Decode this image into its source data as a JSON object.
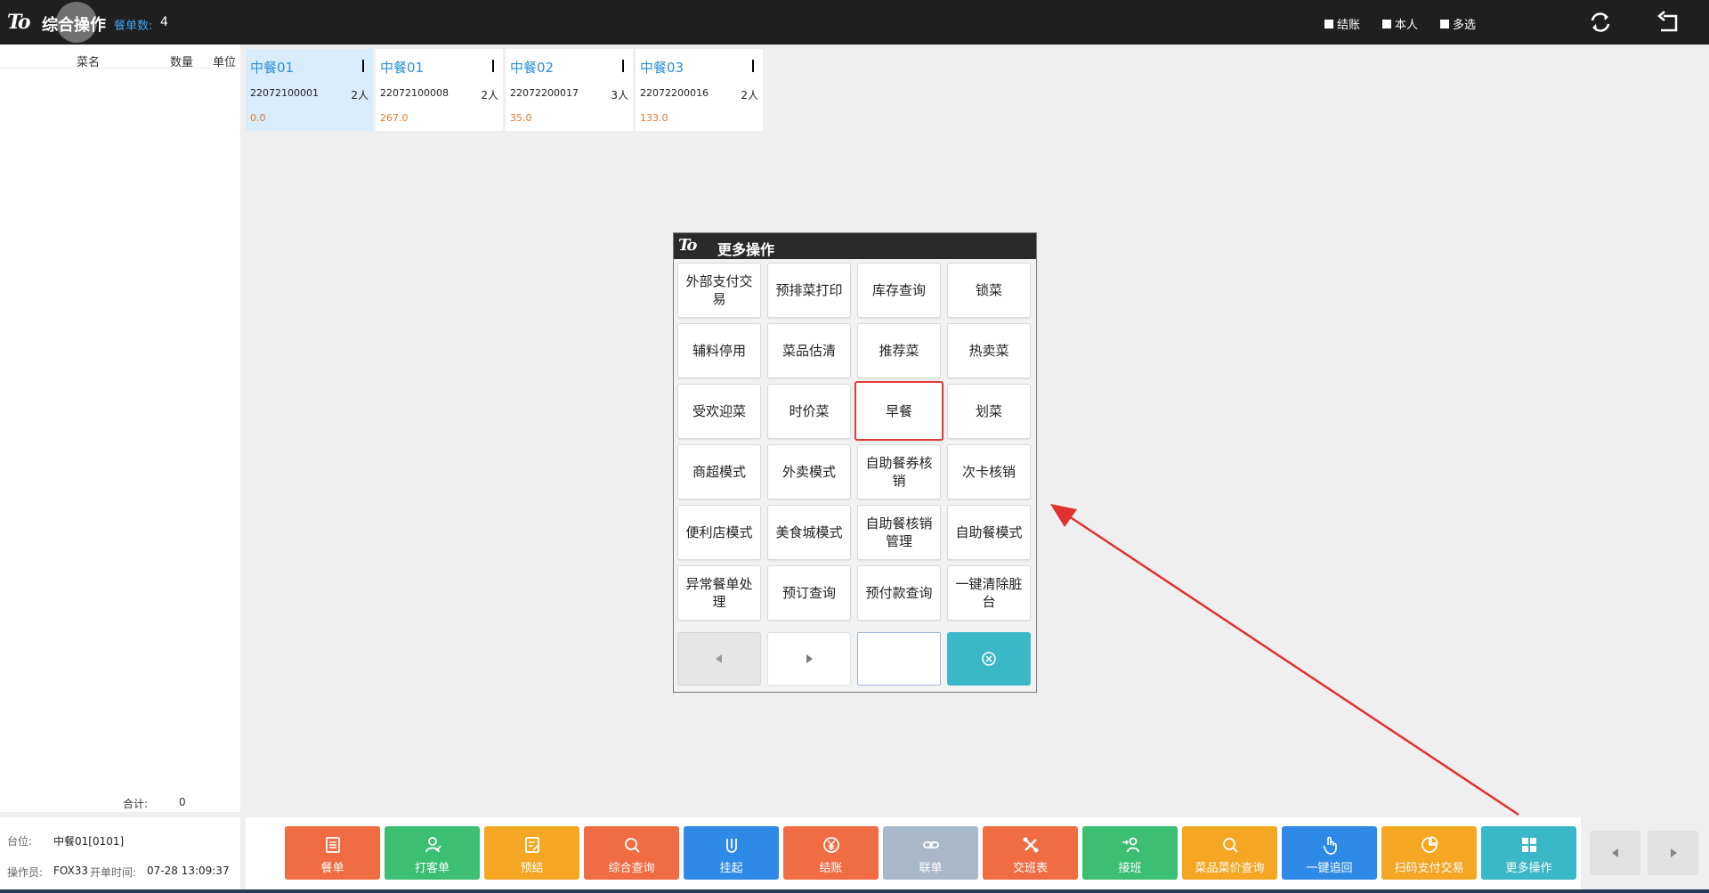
{
  "header": {
    "logo_text": "To",
    "title": "综合操作",
    "order_count_label": "餐单数:",
    "order_count_value": "4",
    "checks": [
      {
        "label": "结账",
        "checked": false
      },
      {
        "label": "本人",
        "checked": false
      },
      {
        "label": "多选",
        "checked": false
      }
    ],
    "refresh_icon": "refresh-icon",
    "back_icon": "return-icon"
  },
  "left_panel": {
    "columns": [
      "菜名",
      "数量",
      "单位"
    ],
    "total_label": "合计:",
    "total_value": "0",
    "table_label": "台位:",
    "table_value": "中餐01[0101]",
    "operator_label": "操作员:",
    "operator_value": "FOX33",
    "open_time_label": "开单时间:",
    "open_time_value": "07-28 13:09:37"
  },
  "orders": [
    {
      "name": "中餐01",
      "no": "22072100001",
      "people": "2人",
      "amount": "0.0",
      "active": true
    },
    {
      "name": "中餐01",
      "no": "22072100008",
      "people": "2人",
      "amount": "267.0",
      "active": false
    },
    {
      "name": "中餐02",
      "no": "22072200017",
      "people": "3人",
      "amount": "35.0",
      "active": false
    },
    {
      "name": "中餐03",
      "no": "22072200016",
      "people": "2人",
      "amount": "133.0",
      "active": false
    }
  ],
  "modal": {
    "logo_text": "To",
    "title": "更多操作",
    "buttons": [
      "外部支付交易",
      "预排菜打印",
      "库存查询",
      "锁菜",
      "辅料停用",
      "菜品估清",
      "推荐菜",
      "热卖菜",
      "受欢迎菜",
      "时价菜",
      "早餐",
      "划菜",
      "商超模式",
      "外卖模式",
      "自助餐券核销",
      "次卡核销",
      "便利店模式",
      "美食城模式",
      "自助餐核销管理",
      "自助餐模式",
      "异常餐单处理",
      "预订查询",
      "预付款查询",
      "一键清除脏台"
    ],
    "highlighted_button": "早餐",
    "page_input_value": "",
    "prev_icon": "triangle-left-icon",
    "next_icon": "triangle-right-icon",
    "close_icon": "close-circle-icon"
  },
  "bottom_buttons": [
    {
      "label": "餐单",
      "color": "#f06c43",
      "icon": "list-icon"
    },
    {
      "label": "打客单",
      "color": "#3cbf73",
      "icon": "user-print-icon"
    },
    {
      "label": "预结",
      "color": "#f5a623",
      "icon": "note-icon"
    },
    {
      "label": "综合查询",
      "color": "#f06c43",
      "icon": "search-icon"
    },
    {
      "label": "挂起",
      "color": "#2e8ae6",
      "icon": "hang-icon"
    },
    {
      "label": "结账",
      "color": "#f06c43",
      "icon": "yen-icon"
    },
    {
      "label": "联单",
      "color": "#a9b8c8",
      "icon": "link-icon"
    },
    {
      "label": "交班表",
      "color": "#f06c43",
      "icon": "tools-icon"
    },
    {
      "label": "接班",
      "color": "#3cbf73",
      "icon": "user-arrow-icon"
    },
    {
      "label": "菜品菜价查询",
      "color": "#f5a623",
      "icon": "search-icon"
    },
    {
      "label": "一键追回",
      "color": "#2e8ae6",
      "icon": "hand-icon"
    },
    {
      "label": "扫码支付交易",
      "color": "#f5a623",
      "icon": "pie-icon"
    },
    {
      "label": "更多操作",
      "color": "#3bb8c8",
      "icon": "grid-icon"
    }
  ]
}
